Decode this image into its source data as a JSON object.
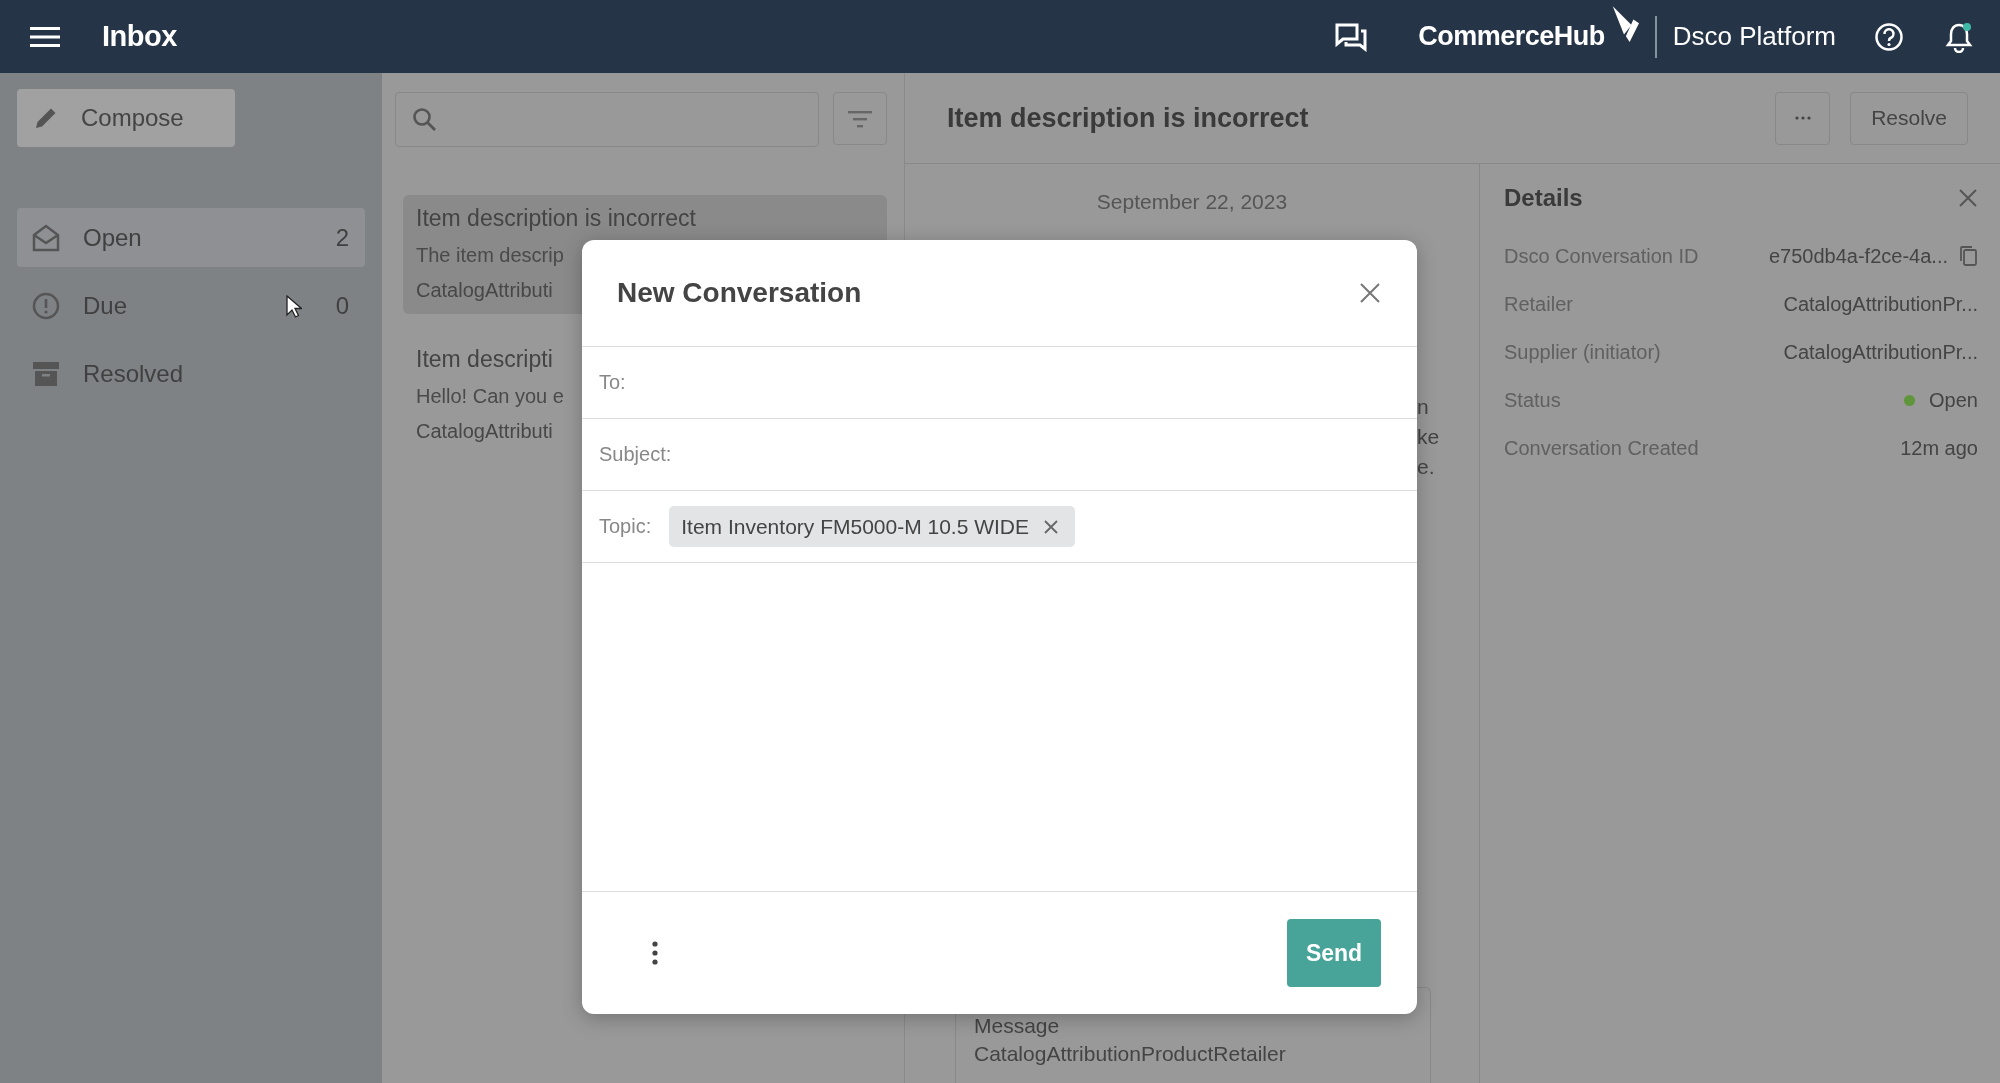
{
  "topbar": {
    "title": "Inbox",
    "brand": "CommerceHub",
    "platform": "Dsco Platform",
    "notification_unread": true
  },
  "sidebar": {
    "compose": "Compose",
    "items": [
      {
        "kind": "open",
        "label": "Open",
        "count": "2",
        "selected": true
      },
      {
        "kind": "due",
        "label": "Due",
        "count": "0",
        "selected": false
      },
      {
        "kind": "resolved",
        "label": "Resolved",
        "selected": false
      }
    ]
  },
  "list": {
    "items": [
      {
        "title": "Item description is incorrect",
        "preview": "The item descrip",
        "sender": "CatalogAttributi",
        "selected": true
      },
      {
        "title": "Item descripti",
        "preview": "Hello! Can you e",
        "sender": "CatalogAttributi",
        "selected": false
      }
    ]
  },
  "conversation": {
    "title": "Item description is incorrect",
    "resolve": "Resolve",
    "date": "September 22, 2023",
    "fragments": [
      "n",
      "ke",
      "e."
    ],
    "message": {
      "label": "Message",
      "sender": "CatalogAttributionProductRetailer"
    }
  },
  "details": {
    "title": "Details",
    "rows": [
      {
        "kind": "copy",
        "label": "Dsco Conversation ID",
        "value": "e750db4a-f2ce-4a..."
      },
      {
        "kind": "text",
        "label": "Retailer",
        "value": "CatalogAttributionPr..."
      },
      {
        "kind": "text",
        "label": "Supplier (initiator)",
        "value": "CatalogAttributionPr..."
      },
      {
        "kind": "status",
        "label": "Status",
        "value": "Open",
        "color": "#5f963c"
      },
      {
        "kind": "time",
        "label": "Conversation Created",
        "value": "12m ago"
      }
    ]
  },
  "modal": {
    "title": "New Conversation",
    "fields": [
      {
        "kind": "text",
        "label": "To:"
      },
      {
        "kind": "text",
        "label": "Subject:"
      },
      {
        "kind": "chips",
        "label": "Topic:",
        "chips": [
          "Item Inventory FM5000-M 10.5 WIDE"
        ]
      }
    ],
    "send": "Send"
  }
}
